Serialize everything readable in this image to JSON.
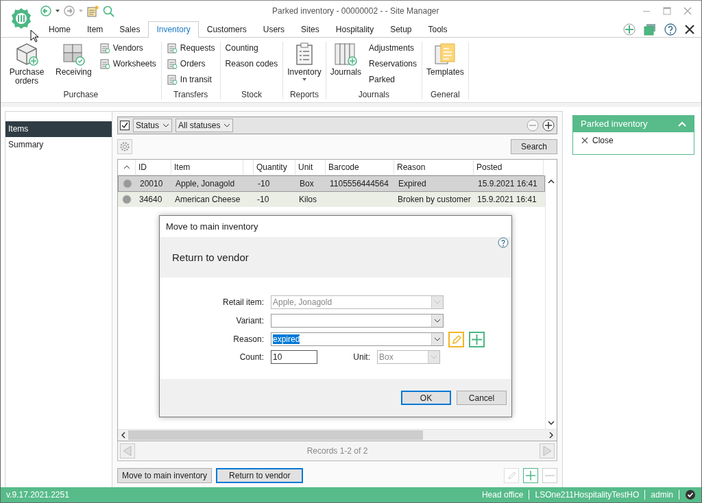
{
  "window": {
    "title": "Parked inventory - 00000002 -  - Site Manager"
  },
  "menu_tabs": [
    {
      "label": "Home",
      "selected": false
    },
    {
      "label": "Item",
      "selected": false
    },
    {
      "label": "Sales",
      "selected": false
    },
    {
      "label": "Inventory",
      "selected": true
    },
    {
      "label": "Customers",
      "selected": false
    },
    {
      "label": "Users",
      "selected": false
    },
    {
      "label": "Sites",
      "selected": false
    },
    {
      "label": "Hospitality",
      "selected": false
    },
    {
      "label": "Setup",
      "selected": false
    },
    {
      "label": "Tools",
      "selected": false
    }
  ],
  "ribbon": [
    {
      "label": "Purchase",
      "items": [
        {
          "kind": "large",
          "label": "Purchase orders"
        },
        {
          "kind": "large",
          "label": "Receiving"
        },
        {
          "kind": "small",
          "label": "Vendors"
        },
        {
          "kind": "small",
          "label": "Worksheets"
        }
      ]
    },
    {
      "label": "Transfers",
      "items": [
        {
          "kind": "small",
          "label": "Requests"
        },
        {
          "kind": "small",
          "label": "Orders"
        },
        {
          "kind": "small",
          "label": "In transit"
        }
      ]
    },
    {
      "label": "Stock",
      "items": [
        {
          "kind": "plain",
          "label": "Counting"
        },
        {
          "kind": "plain",
          "label": "Reason codes"
        }
      ]
    },
    {
      "label": "Reports",
      "items": [
        {
          "kind": "dropdown",
          "label": "Inventory"
        }
      ]
    },
    {
      "label": "Journals",
      "items": [
        {
          "kind": "large",
          "label": "Journals"
        },
        {
          "kind": "plain",
          "label": "Adjustments"
        },
        {
          "kind": "plain",
          "label": "Reservations"
        },
        {
          "kind": "plain",
          "label": "Parked"
        }
      ]
    },
    {
      "label": "General",
      "items": [
        {
          "kind": "large",
          "label": "Templates"
        }
      ]
    }
  ],
  "sidebar": {
    "items": [
      {
        "label": "Items",
        "selected": true
      },
      {
        "label": "Summary",
        "selected": false
      }
    ]
  },
  "filter": {
    "checked": true,
    "field": "Status",
    "value": "All statuses"
  },
  "search_button": "Search",
  "table": {
    "columns": [
      "ID",
      "Item",
      "Quantity",
      "Unit",
      "Barcode",
      "Reason",
      "Posted"
    ],
    "rows": [
      {
        "selected": true,
        "cells": [
          "20010",
          "Apple, Jonagold",
          "-10",
          "Box",
          "1105556444564",
          "Expired",
          "15.9.2021 16:41"
        ]
      },
      {
        "selected": false,
        "cells": [
          "34640",
          "American Cheese",
          "-10",
          "Kilos",
          "",
          "Broken by customer",
          "15.9.2021 16:41"
        ]
      }
    ]
  },
  "pager": "Records 1-2 of 2",
  "actions": [
    {
      "label": "Move to main inventory",
      "focused": false
    },
    {
      "label": "Return to vendor",
      "focused": true
    }
  ],
  "side_panel": {
    "title": "Parked inventory",
    "items": [
      "Close"
    ]
  },
  "dialog": {
    "title": "Move to main inventory",
    "heading": "Return to vendor",
    "fields": [
      {
        "label": "Retail item:",
        "value": "Apple, Jonagold",
        "disabled": true
      },
      {
        "label": "Variant:",
        "disabled": false
      },
      {
        "label": "Reason:",
        "value": "expired",
        "disabled": false,
        "highlighted": true
      },
      {
        "label": "Count:",
        "value": "10",
        "disabled": false
      },
      {
        "label": "Unit:",
        "value": "Box",
        "disabled": true
      }
    ],
    "buttons": [
      {
        "label": "OK",
        "default": true
      },
      {
        "label": "Cancel",
        "default": false
      }
    ]
  },
  "status_bar": {
    "version": "v.9.17.2021.2251",
    "items": [
      "Head office",
      "LSOne211HospitalityTestHO",
      "admin"
    ]
  }
}
